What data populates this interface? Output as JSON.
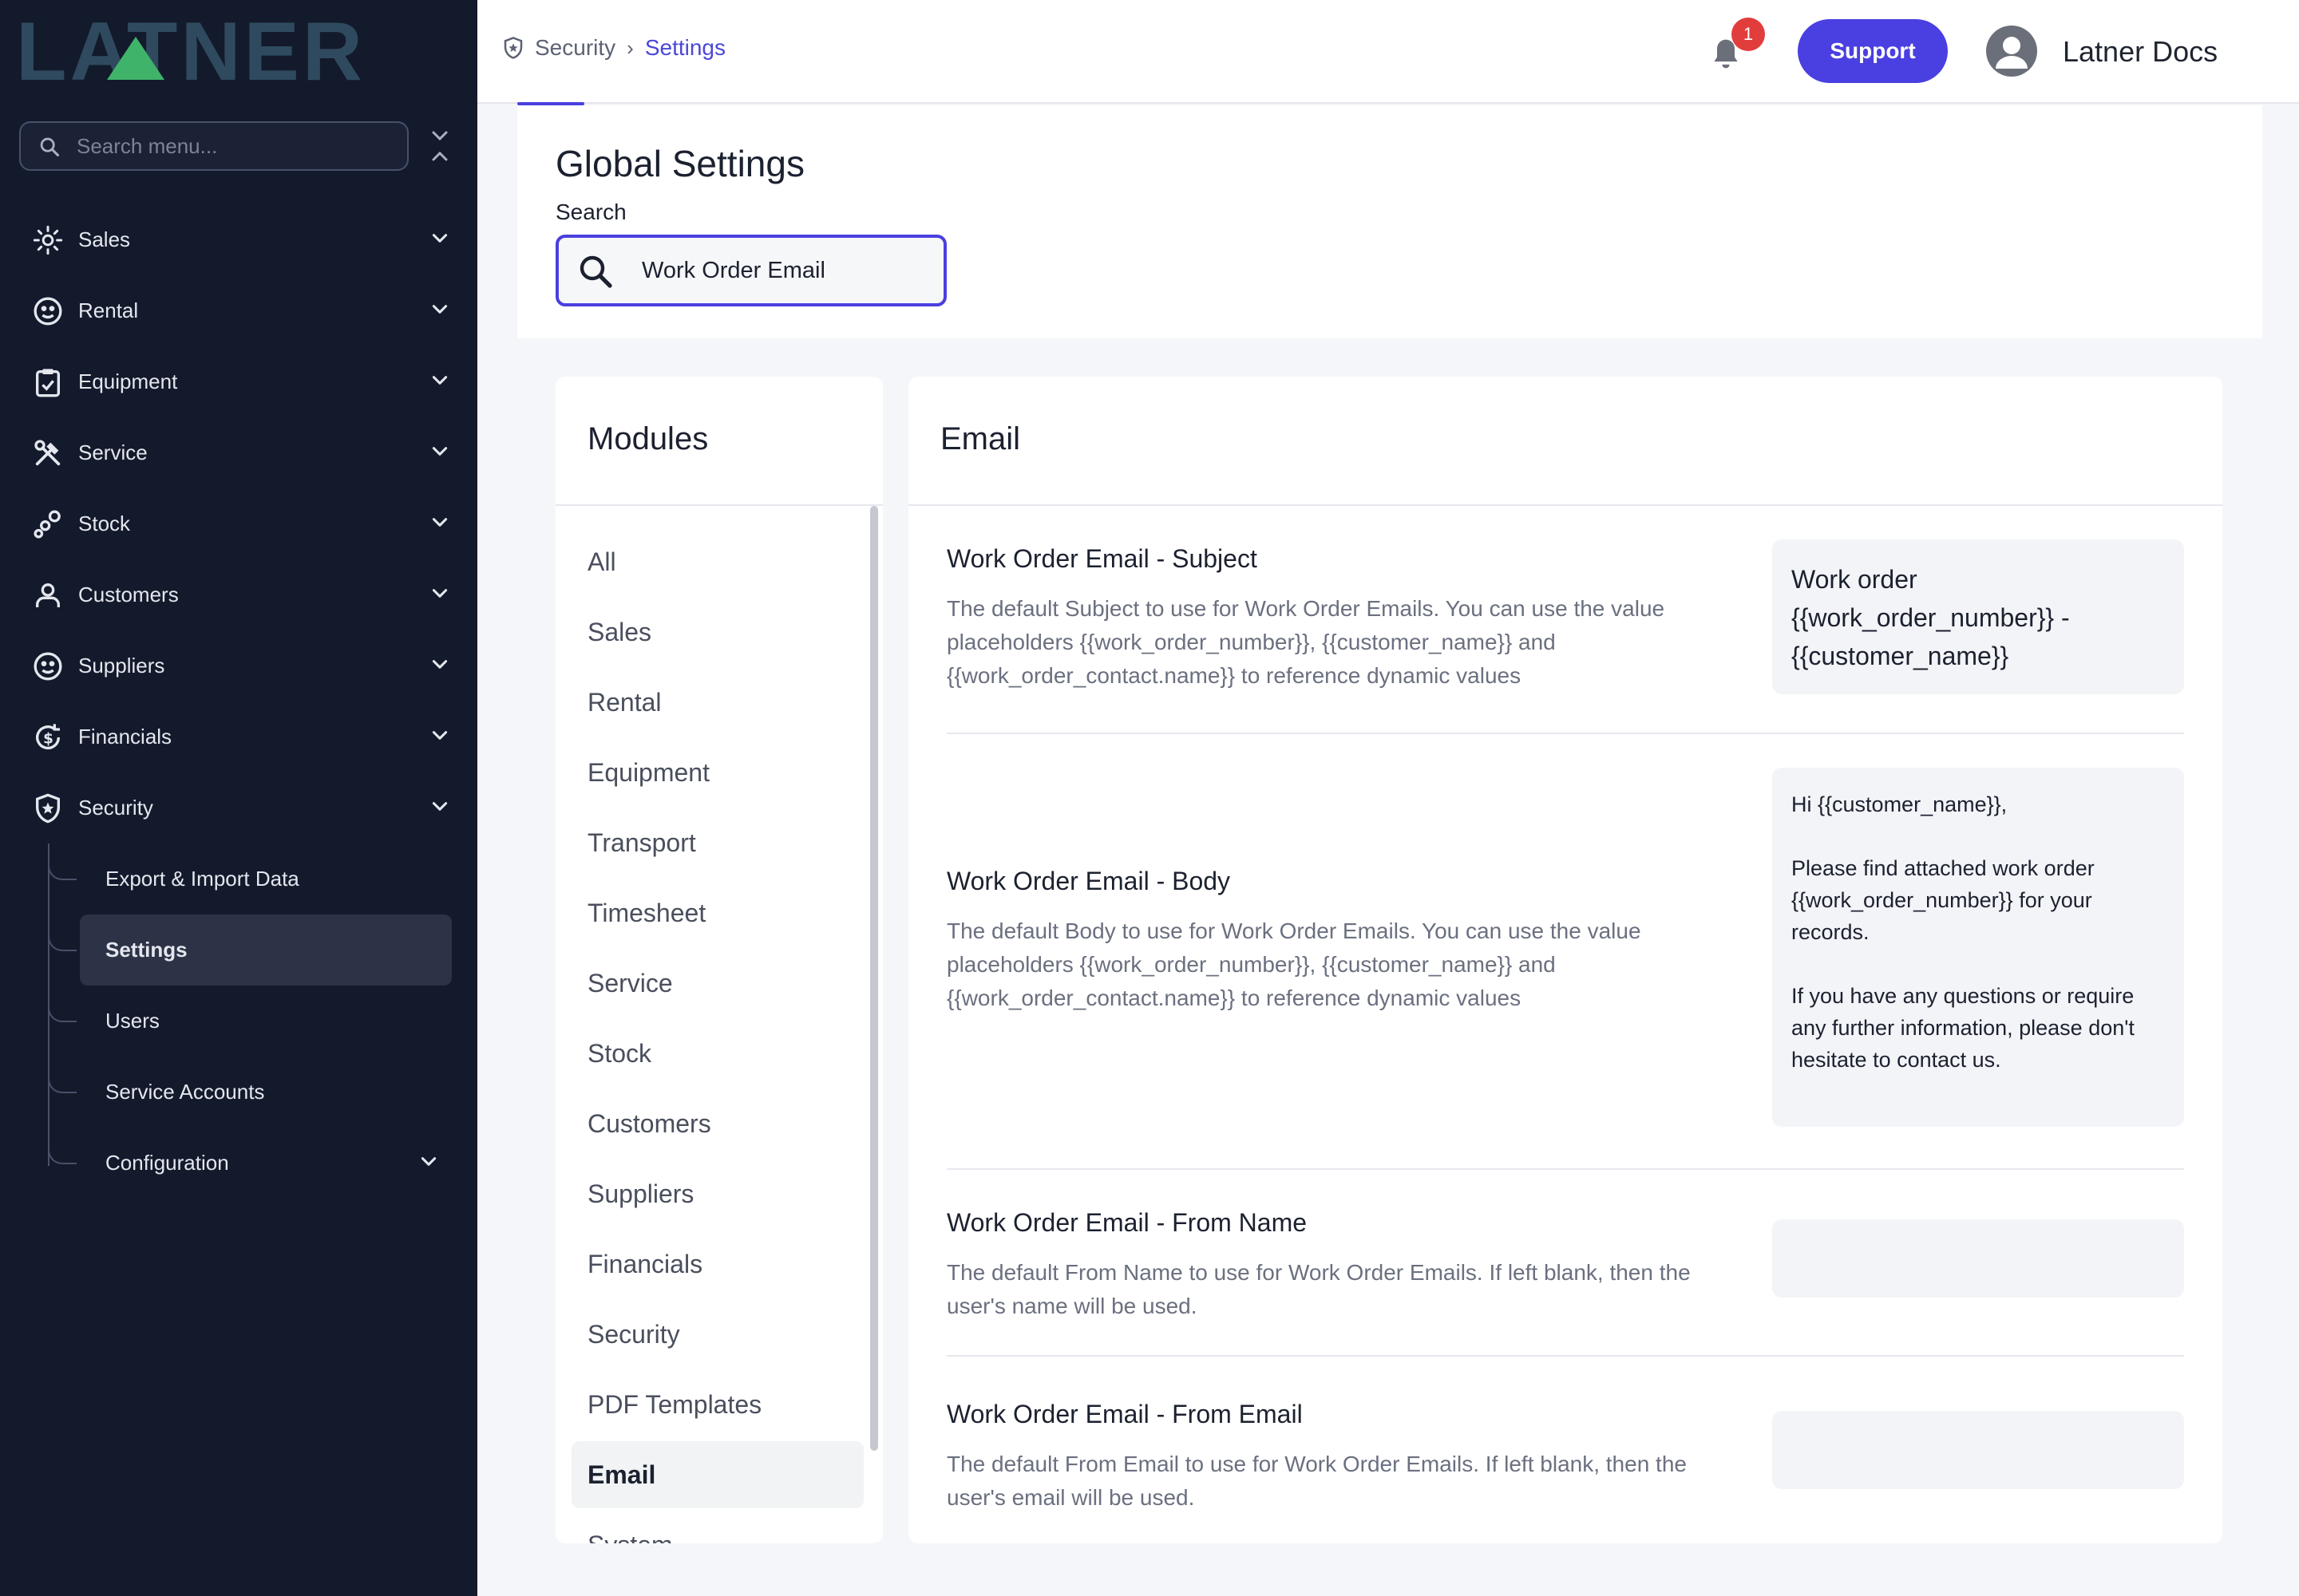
{
  "sidebar": {
    "logo_text": "LATNER",
    "search_placeholder": "Search menu...",
    "items": [
      {
        "label": "Sales",
        "icon": "sales-icon"
      },
      {
        "label": "Rental",
        "icon": "rental-icon"
      },
      {
        "label": "Equipment",
        "icon": "equipment-icon"
      },
      {
        "label": "Service",
        "icon": "service-icon"
      },
      {
        "label": "Stock",
        "icon": "stock-icon"
      },
      {
        "label": "Customers",
        "icon": "customers-icon"
      },
      {
        "label": "Suppliers",
        "icon": "suppliers-icon"
      },
      {
        "label": "Financials",
        "icon": "financials-icon"
      },
      {
        "label": "Security",
        "icon": "security-icon"
      }
    ],
    "security_sub": [
      {
        "label": "Export & Import Data"
      },
      {
        "label": "Settings",
        "active": true
      },
      {
        "label": "Users"
      },
      {
        "label": "Service Accounts"
      },
      {
        "label": "Configuration"
      }
    ]
  },
  "topbar": {
    "breadcrumb": [
      "Security",
      "Settings"
    ],
    "notification_count": "1",
    "support_label": "Support",
    "user_name": "Latner Docs"
  },
  "global": {
    "title": "Global Settings",
    "search_label": "Search",
    "search_value": "Work Order Email"
  },
  "modules": {
    "title": "Modules",
    "items": [
      "All",
      "Sales",
      "Rental",
      "Equipment",
      "Transport",
      "Timesheet",
      "Service",
      "Stock",
      "Customers",
      "Suppliers",
      "Financials",
      "Security",
      "PDF Templates",
      "Email",
      "System"
    ],
    "active": "Email"
  },
  "email": {
    "title": "Email",
    "settings": [
      {
        "title": "Work Order Email - Subject",
        "description": "The default Subject to use for Work Order Emails. You can use the value placeholders {{work_order_number}}, {{customer_name}} and {{work_order_contact.name}} to reference dynamic values",
        "value": "Work order {{work_order_number}} - {{customer_name}}"
      },
      {
        "title": "Work Order Email - Body",
        "description": "The default Body to use for Work Order Emails. You can use the value placeholders {{work_order_number}}, {{customer_name}} and {{work_order_contact.name}} to reference dynamic values",
        "value": "Hi {{customer_name}},\n\nPlease find attached work order {{work_order_number}} for your records.\n\nIf you have any questions or require any further information, please don't hesitate to contact us."
      },
      {
        "title": "Work Order Email - From Name",
        "description": "The default From Name to use for Work Order Emails. If left blank, then the user's name will be used.",
        "value": ""
      },
      {
        "title": "Work Order Email - From Email",
        "description": "The default From Email to use for Work Order Emails. If left blank, then the user's email will be used.",
        "value": ""
      }
    ]
  },
  "colors": {
    "sidebar_bg": "#131a2c",
    "accent": "#4a3fe0",
    "badge": "#e23d3d",
    "logo": "#2f4a5e",
    "logo_accent": "#3fb36a"
  }
}
